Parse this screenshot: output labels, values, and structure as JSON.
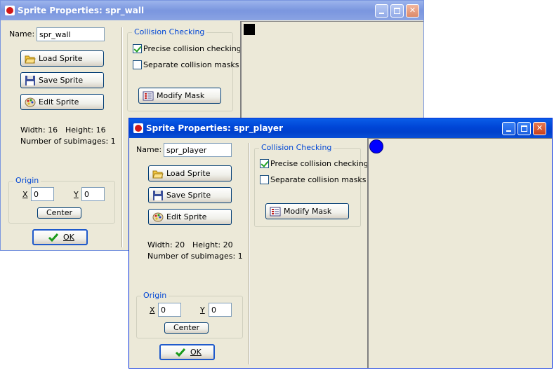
{
  "windows": {
    "wall": {
      "title": "Sprite Properties: spr_wall",
      "name_label": "Name:",
      "name_value": "spr_wall",
      "load_sprite": "Load Sprite",
      "save_sprite": "Save Sprite",
      "edit_sprite": "Edit Sprite",
      "width_text": "Width: 16",
      "height_text": "Height: 16",
      "subimages_text": "Number of subimages: 1",
      "origin_label": "Origin",
      "x_label": "X",
      "x_value": "0",
      "y_label": "Y",
      "y_value": "0",
      "center": "Center",
      "ok": "OK",
      "collision_label": "Collision Checking",
      "precise_label": "Precise collision checking",
      "precise_checked": true,
      "separate_label": "Separate collision masks",
      "separate_checked": false,
      "modify_mask": "Modify Mask",
      "sprite_color": "#000000",
      "active": false
    },
    "player": {
      "title": "Sprite Properties: spr_player",
      "name_label": "Name:",
      "name_value": "spr_player",
      "load_sprite": "Load Sprite",
      "save_sprite": "Save Sprite",
      "edit_sprite": "Edit Sprite",
      "width_text": "Width: 20",
      "height_text": "Height: 20",
      "subimages_text": "Number of subimages: 1",
      "origin_label": "Origin",
      "x_label": "X",
      "x_value": "0",
      "y_label": "Y",
      "y_value": "0",
      "center": "Center",
      "ok": "OK",
      "collision_label": "Collision Checking",
      "precise_label": "Precise collision checking",
      "precise_checked": true,
      "separate_label": "Separate collision masks",
      "separate_checked": false,
      "modify_mask": "Modify Mask",
      "sprite_color": "#0000ff",
      "active": true
    }
  },
  "icons": {
    "app": "game-maker-icon",
    "load": "folder-open-icon",
    "save": "floppy-disk-icon",
    "edit": "paint-palette-icon",
    "mask": "mask-grid-icon",
    "ok": "green-check-icon"
  }
}
